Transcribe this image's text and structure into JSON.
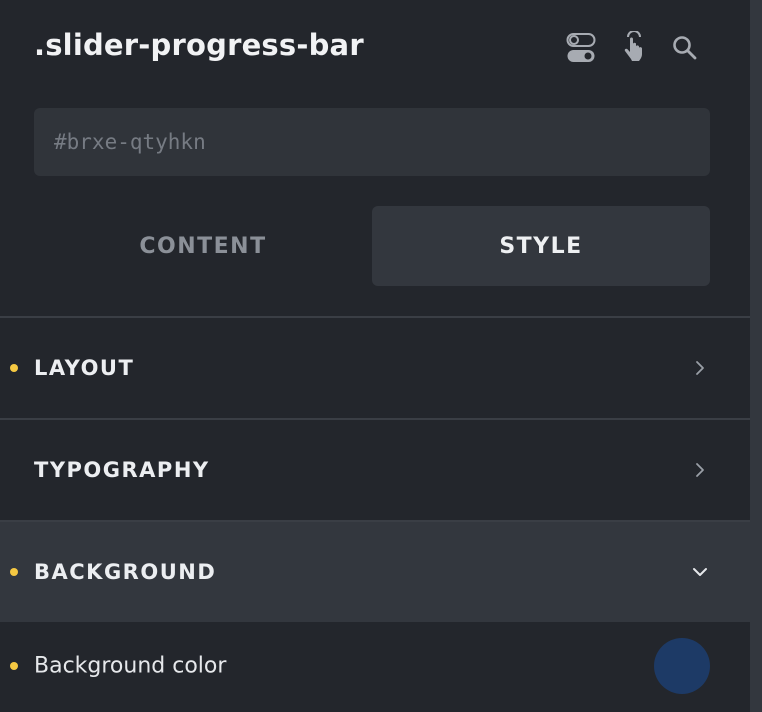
{
  "header": {
    "title": ".slider-progress-bar",
    "icons": [
      "toggle-icon",
      "pointer-hand-icon",
      "search-icon"
    ]
  },
  "id_field": {
    "value": "",
    "placeholder": "#brxe-qtyhkn"
  },
  "tabs": [
    {
      "label": "CONTENT",
      "active": false
    },
    {
      "label": "STYLE",
      "active": true
    }
  ],
  "sections": [
    {
      "label": "LAYOUT",
      "has_value": true,
      "expanded": false
    },
    {
      "label": "TYPOGRAPHY",
      "has_value": false,
      "expanded": false
    },
    {
      "label": "BACKGROUND",
      "has_value": true,
      "expanded": true
    }
  ],
  "controls": {
    "background_color": {
      "label": "Background color",
      "has_value": true,
      "color": "#1d3a66"
    }
  },
  "colors": {
    "panel_bg": "#23262c",
    "active_bg": "#33373e",
    "indicator": "#f5c842",
    "text": "#eceef1",
    "muted": "#8b9098"
  }
}
